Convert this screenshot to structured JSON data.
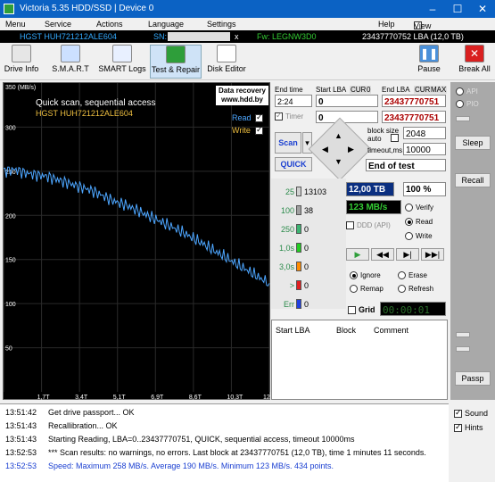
{
  "window": {
    "title": "Victoria 5.35 HDD/SSD | Device 0"
  },
  "menu": {
    "items": [
      "Menu",
      "Service",
      "Actions",
      "Language",
      "Settings",
      "Help"
    ],
    "view_buffer": "View Buffer Live"
  },
  "info": {
    "model": "HGST HUH721212ALE604",
    "sn_label": "SN:",
    "close": "x",
    "fw": "Fw: LEGNW3D0",
    "lba": "23437770752 LBA (12,0 TB)"
  },
  "toolbar": {
    "drive_info": "Drive Info",
    "smart": "S.M.A.R.T",
    "smart_logs": "SMART Logs",
    "test_repair": "Test & Repair",
    "disk_editor": "Disk Editor",
    "pause": "Pause",
    "break_all": "Break All"
  },
  "graph": {
    "speed_max_label": "350 (MB/s)",
    "title": "Quick scan, sequential access",
    "model": "HGST HUH721212ALE604",
    "recovery_line1": "Data recovery",
    "recovery_line2": "www.hdd.by",
    "read_label": "Read",
    "write_label": "Write",
    "y_ticks": [
      "300",
      "250",
      "200",
      "150",
      "100",
      "50"
    ],
    "x_ticks": [
      "0",
      "1,7T",
      "3,4T",
      "5,1T",
      "6,9T",
      "8,6T",
      "10,3T",
      "12"
    ],
    "curve_color": "#4da6ff"
  },
  "chart_data": {
    "type": "line",
    "title": "Quick scan, sequential access",
    "xlabel": "",
    "ylabel": "(MB/s)",
    "ylim": [
      0,
      350
    ],
    "xlim": [
      0,
      12
    ],
    "series": [
      {
        "name": "Read",
        "x": [
          0,
          0.5,
          1,
          1.5,
          2,
          2.5,
          3,
          3.5,
          4,
          4.5,
          5,
          5.5,
          6,
          6.5,
          7,
          7.5,
          8,
          8.5,
          9,
          9.5,
          10,
          10.5,
          11,
          11.5,
          12
        ],
        "y": [
          250,
          252,
          248,
          246,
          244,
          240,
          236,
          232,
          228,
          222,
          216,
          212,
          206,
          200,
          194,
          188,
          182,
          175,
          168,
          160,
          153,
          145,
          138,
          130,
          123
        ]
      }
    ]
  },
  "controls": {
    "end_time_label": "End time",
    "end_time_value": "2:24",
    "start_lba_label": "Start LBA",
    "cur_label": "CUR",
    "zero_label": "0",
    "start_lba_value": "0",
    "end_lba_label": "End LBA",
    "max_label": "MAX",
    "end_lba_value": "23437770751",
    "timer_label": "Timer",
    "timer_value": "0",
    "cur_lba_value": "23437770751",
    "block_size_label": "block size",
    "auto_label": "auto",
    "block_size_value": "2048",
    "timeout_label": "timeout,ms",
    "timeout_value": "10000",
    "scan_button": "Scan",
    "quick_button": "QUICK",
    "end_mode": "End of test",
    "counts": [
      {
        "label": "25",
        "value": "13103",
        "color": "#d0d0d0"
      },
      {
        "label": "100",
        "value": "38",
        "color": "#a0a0a0"
      },
      {
        "label": "250",
        "value": "0",
        "color": "#3cb371"
      },
      {
        "label": "1,0s",
        "value": "0",
        "color": "#22cc22"
      },
      {
        "label": "3,0s",
        "value": "0",
        "color": "#ff8c00"
      },
      {
        "label": ">",
        "value": "0",
        "color": "#e02020"
      },
      {
        "label": "Err",
        "value": "0",
        "color": "#2040e0"
      }
    ],
    "capacity": "12,00 TB",
    "percent": "100",
    "percent_unit": "%",
    "speed": "123 MB/s",
    "ddd_label": "DDD (API)",
    "verify_label": "Verify",
    "read_label": "Read",
    "write_label": "Write",
    "ignore_label": "Ignore",
    "erase_label": "Erase",
    "remap_label": "Remap",
    "refresh_label": "Refresh",
    "grid_label": "Grid",
    "grid_time": "00:00:01",
    "table_cols": [
      "Start LBA",
      "Block",
      "Comment"
    ]
  },
  "right": {
    "api": "API",
    "pio": "PIO",
    "sleep": "Sleep",
    "recall": "Recall",
    "passp": "Passp"
  },
  "log": [
    {
      "time": "13:51:42",
      "msg": "Get drive passport... OK",
      "color": "#000000"
    },
    {
      "time": "13:51:43",
      "msg": "Recallibration... OK",
      "color": "#000000"
    },
    {
      "time": "13:51:43",
      "msg": "Starting Reading, LBA=0..23437770751, QUICK, sequential access, timeout 10000ms",
      "color": "#000000"
    },
    {
      "time": "13:52:53",
      "msg": "*** Scan results: no warnings, no errors. Last block at 23437770751 (12,0 TB), time 1 minutes 11 seconds.",
      "color": "#000000"
    },
    {
      "time": "13:52:53",
      "msg": "Speed: Maximum 258 MB/s. Average 190 MB/s. Minimum 123 MB/s. 434 points.",
      "color": "#1a3fd1"
    }
  ],
  "options": {
    "sound": "Sound",
    "hints": "Hints"
  }
}
